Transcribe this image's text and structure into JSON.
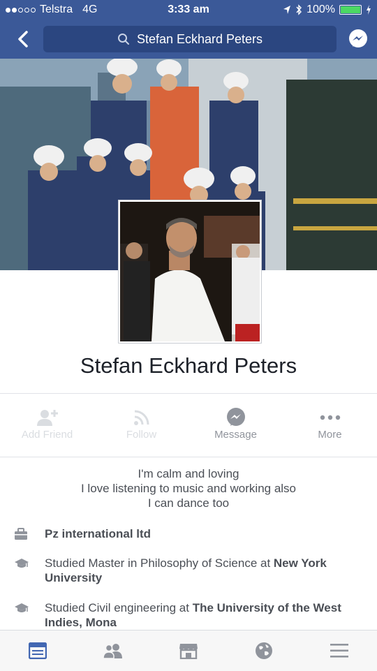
{
  "status_bar": {
    "carrier": "Telstra",
    "network": "4G",
    "time": "3:33 am",
    "battery": "100%"
  },
  "header": {
    "search_text": "Stefan Eckhard Peters"
  },
  "profile": {
    "name": "Stefan Eckhard Peters"
  },
  "actions": [
    {
      "label": "Add Friend",
      "icon": "add-friend-icon",
      "enabled": false
    },
    {
      "label": "Follow",
      "icon": "follow-icon",
      "enabled": false
    },
    {
      "label": "Message",
      "icon": "messenger-icon",
      "enabled": true
    },
    {
      "label": "More",
      "icon": "more-icon",
      "enabled": true
    }
  ],
  "bio": {
    "line1": "I'm calm and loving",
    "line2": "I love listening to music and working also",
    "line3": "I can dance too"
  },
  "info": {
    "work": "Pz international ltd",
    "edu1_prefix": "Studied Master in Philosophy of Science at ",
    "edu1_school": "New York University",
    "edu2_prefix": "Studied Civil engineering at ",
    "edu2_school": "The University of the West Indies, Mona"
  },
  "colors": {
    "brand": "#3b5998",
    "active_tab": "#4267b2"
  },
  "tabs": [
    {
      "icon": "news-feed-icon",
      "active": true
    },
    {
      "icon": "friends-icon",
      "active": false
    },
    {
      "icon": "marketplace-icon",
      "active": false
    },
    {
      "icon": "notifications-globe-icon",
      "active": false
    },
    {
      "icon": "menu-icon",
      "active": false
    }
  ]
}
